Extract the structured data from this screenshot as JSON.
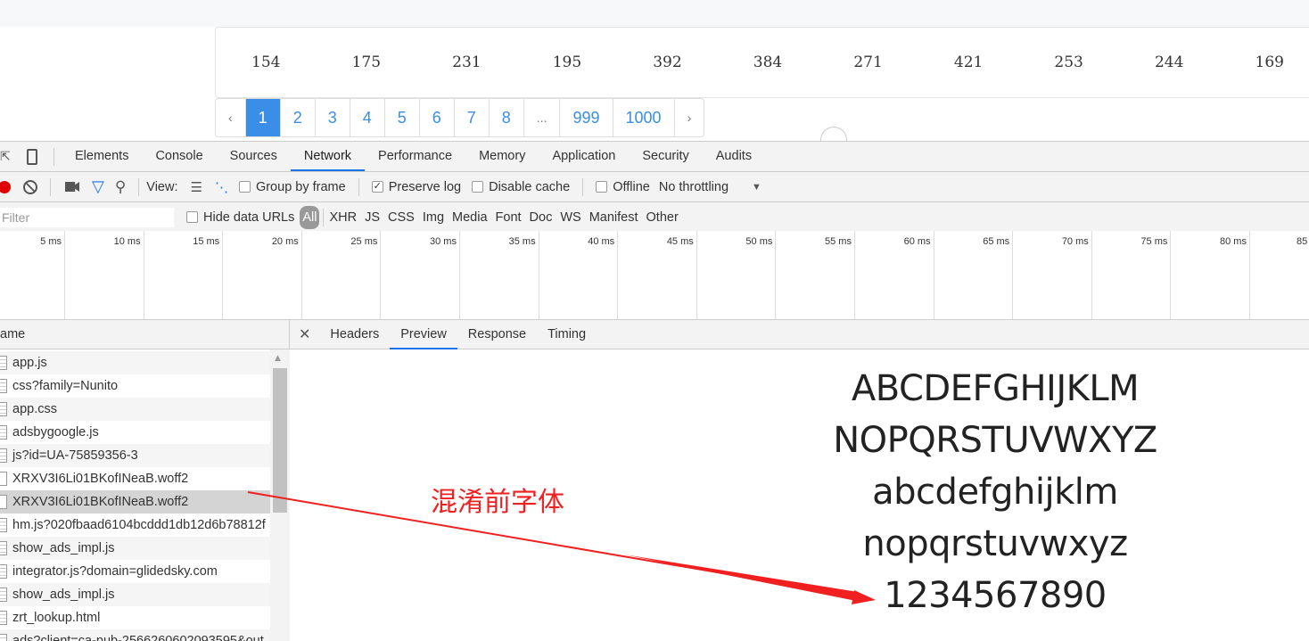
{
  "numbers": [
    "154",
    "175",
    "231",
    "195",
    "392",
    "384",
    "271",
    "421",
    "253",
    "244",
    "169"
  ],
  "pagination": {
    "prev": "‹",
    "pages": [
      "1",
      "2",
      "3",
      "4",
      "5",
      "6",
      "7",
      "8",
      "...",
      "999",
      "1000"
    ],
    "active": "1",
    "next": "›"
  },
  "devtools": {
    "tabs": [
      "Elements",
      "Console",
      "Sources",
      "Network",
      "Performance",
      "Memory",
      "Application",
      "Security",
      "Audits"
    ],
    "active_tab": "Network",
    "toolbar": {
      "view_label": "View:",
      "group_by_frame": "Group by frame",
      "preserve_log": "Preserve log",
      "preserve_log_checked": true,
      "disable_cache": "Disable cache",
      "offline": "Offline",
      "throttling": "No throttling"
    },
    "filterbar": {
      "placeholder": "Filter",
      "filter_visible": "ilter",
      "hide_data_urls": "Hide data URLs",
      "types": [
        "All",
        "XHR",
        "JS",
        "CSS",
        "Img",
        "Media",
        "Font",
        "Doc",
        "WS",
        "Manifest",
        "Other"
      ]
    },
    "timeline_ticks": [
      "5 ms",
      "10 ms",
      "15 ms",
      "20 ms",
      "25 ms",
      "30 ms",
      "35 ms",
      "40 ms",
      "45 ms",
      "50 ms",
      "55 ms",
      "60 ms",
      "65 ms",
      "70 ms",
      "75 ms",
      "80 ms",
      "85"
    ],
    "name_header": "ame",
    "requests": [
      "app.js",
      "css?family=Nunito",
      "app.css",
      "adsbygoogle.js",
      "js?id=UA-75859356-3",
      "XRXV3I6Li01BKofINeaB.woff2",
      "XRXV3I6Li01BKofINeaB.woff2",
      "hm.js?020fbaad6104bcddd1db12d6b78812f",
      "show_ads_impl.js",
      "integrator.js?domain=glidedsky.com",
      "show_ads_impl.js",
      "zrt_lookup.html",
      "ads?client=ca-pub-2566260602093595&out"
    ],
    "selected_request": 6,
    "detail_tabs": [
      "Headers",
      "Preview",
      "Response",
      "Timing"
    ],
    "active_detail_tab": "Preview",
    "preview_lines": [
      "ABCDEFGHIJKLM",
      "NOPQRSTUVWXYZ",
      "abcdefghijklm",
      "nopqrstuvwxyz",
      "1234567890"
    ]
  },
  "annotation": {
    "text": "混淆前字体",
    "color": "#f02020"
  },
  "colors": {
    "accent": "#3a8ee6",
    "devtools_blue": "#1a73e8",
    "record": "#e00000"
  }
}
